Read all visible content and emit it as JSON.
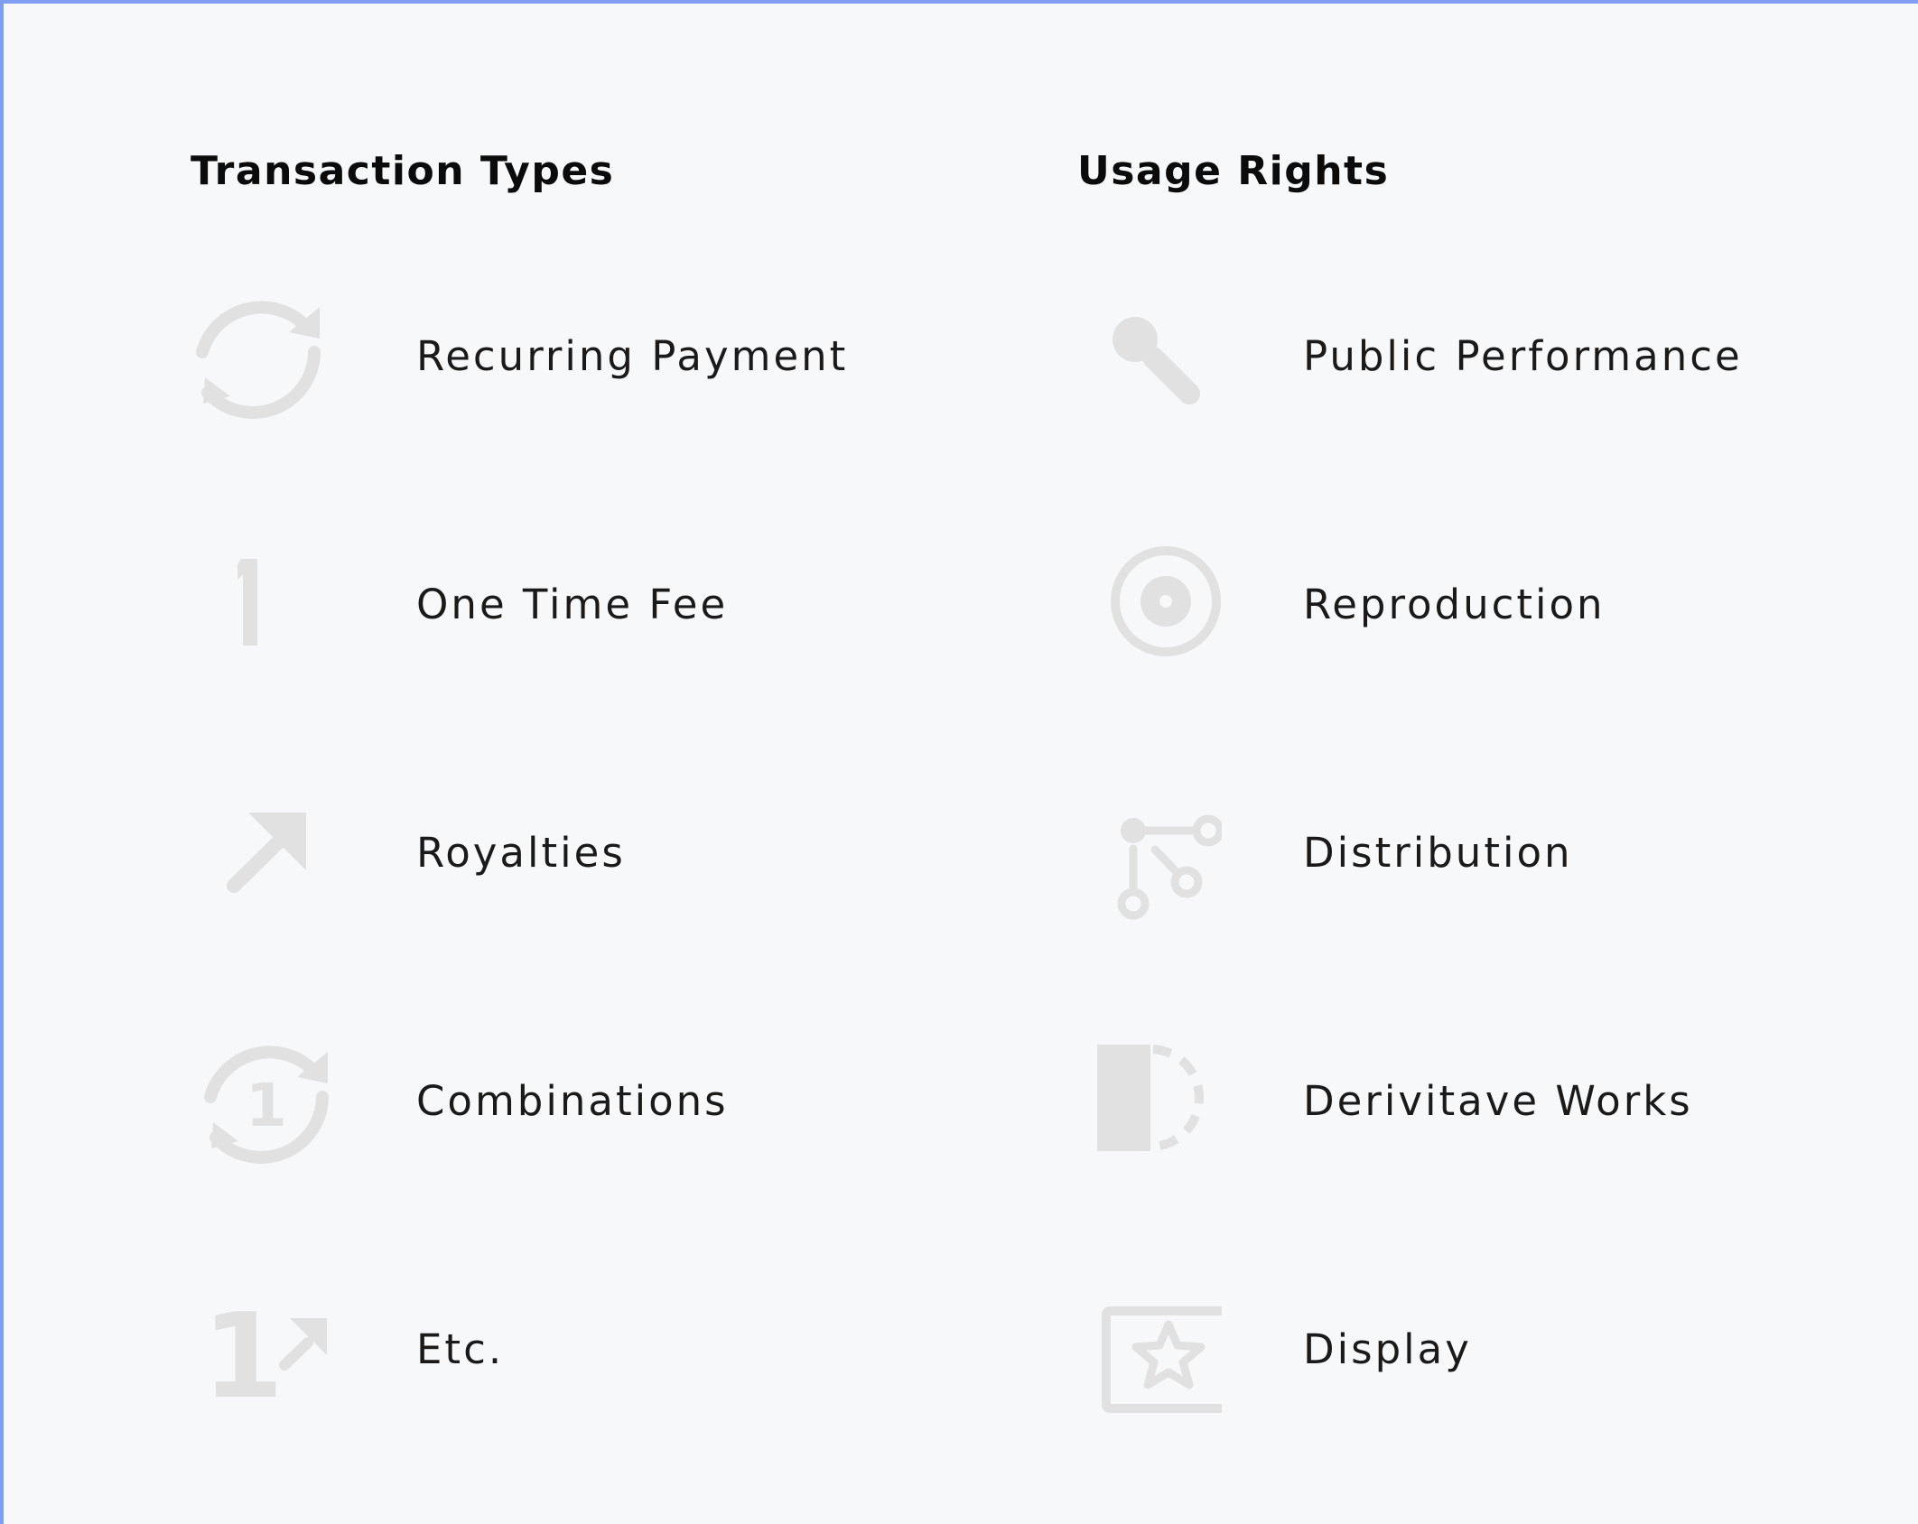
{
  "theme": {
    "icon_color": "#e1e1e1",
    "text_color": "#1a1a1a",
    "heading_color": "#0b0b0b",
    "background": "#f6f8fa",
    "frame_accent": "#7f9ef0"
  },
  "transaction_types": {
    "heading": "Transaction Types",
    "items": [
      {
        "label": "Recurring Payment",
        "icon": "recurring-arrows-icon"
      },
      {
        "label": "One Time Fee",
        "icon": "number-one-icon"
      },
      {
        "label": "Royalties",
        "icon": "arrow-up-right-icon"
      },
      {
        "label": "Combinations",
        "icon": "recurring-one-icon",
        "glyph": "1"
      },
      {
        "label": "Etc.",
        "icon": "one-arrow-icon",
        "glyph": "1"
      }
    ]
  },
  "usage_rights": {
    "heading": "Usage Rights",
    "items": [
      {
        "label": "Public Performance",
        "icon": "microphone-icon"
      },
      {
        "label": "Reproduction",
        "icon": "disc-icon"
      },
      {
        "label": "Distribution",
        "icon": "branch-nodes-icon"
      },
      {
        "label": "Derivitave Works",
        "icon": "half-circle-dashed-icon"
      },
      {
        "label": "Display",
        "icon": "framed-star-icon"
      }
    ]
  }
}
